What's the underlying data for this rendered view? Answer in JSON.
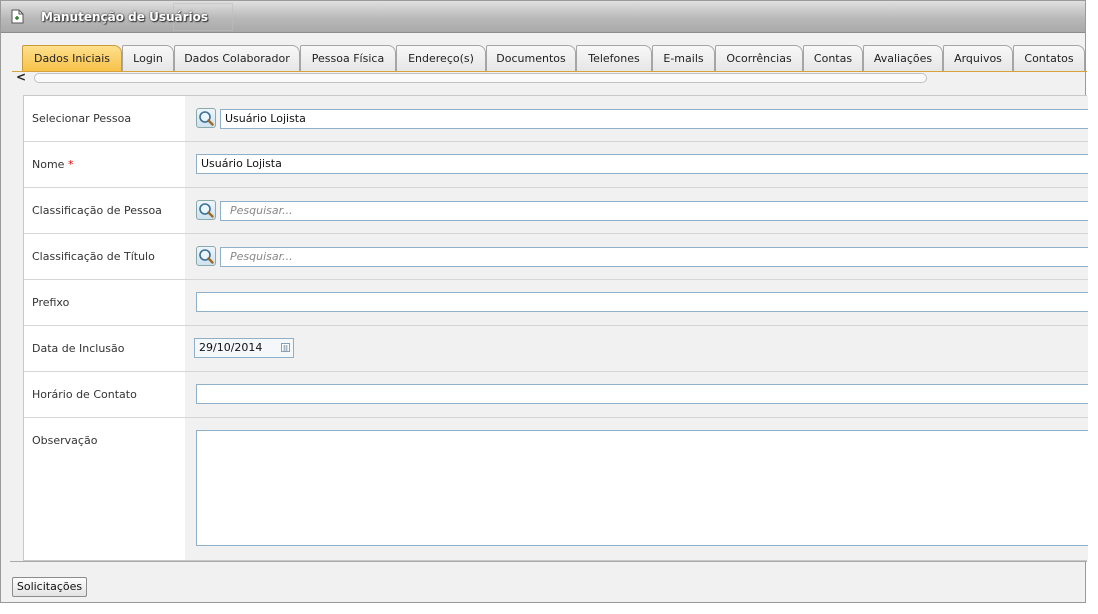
{
  "window": {
    "title": "Manutenção de Usuários"
  },
  "tabs": [
    {
      "label": "Dados Iniciais",
      "active": true
    },
    {
      "label": "Login"
    },
    {
      "label": "Dados Colaborador"
    },
    {
      "label": "Pessoa Física"
    },
    {
      "label": "Endereço(s)"
    },
    {
      "label": "Documentos"
    },
    {
      "label": "Telefones"
    },
    {
      "label": "E-mails"
    },
    {
      "label": "Ocorrências"
    },
    {
      "label": "Contas"
    },
    {
      "label": "Avaliações"
    },
    {
      "label": "Arquivos"
    },
    {
      "label": "Contatos"
    }
  ],
  "scroller": {
    "left_arrow": "<"
  },
  "form": {
    "selecionar_pessoa": {
      "label": "Selecionar Pessoa",
      "value": "Usuário Lojista"
    },
    "nome": {
      "label": "Nome",
      "required_mark": "*",
      "value": "Usuário Lojista"
    },
    "classificacao_pessoa": {
      "label": "Classificação de Pessoa",
      "placeholder": "Pesquisar..."
    },
    "classificacao_titulo": {
      "label": "Classificação de Título",
      "placeholder": "Pesquisar..."
    },
    "prefixo": {
      "label": "Prefixo",
      "value": ""
    },
    "data_inclusao": {
      "label": "Data de Inclusão",
      "value": "29/10/2014"
    },
    "horario_contato": {
      "label": "Horário de Contato",
      "value": ""
    },
    "observacao": {
      "label": "Observação",
      "value": ""
    }
  },
  "footer": {
    "solicitacoes_label": "Solicitações"
  },
  "colors": {
    "active_tab": "#f7c24a",
    "required": "#dd0000",
    "field_border": "#8fb0c8"
  },
  "icons": {
    "title": "page-icon",
    "lookup": "magnifier-icon",
    "calendar": "calendar-icon"
  }
}
